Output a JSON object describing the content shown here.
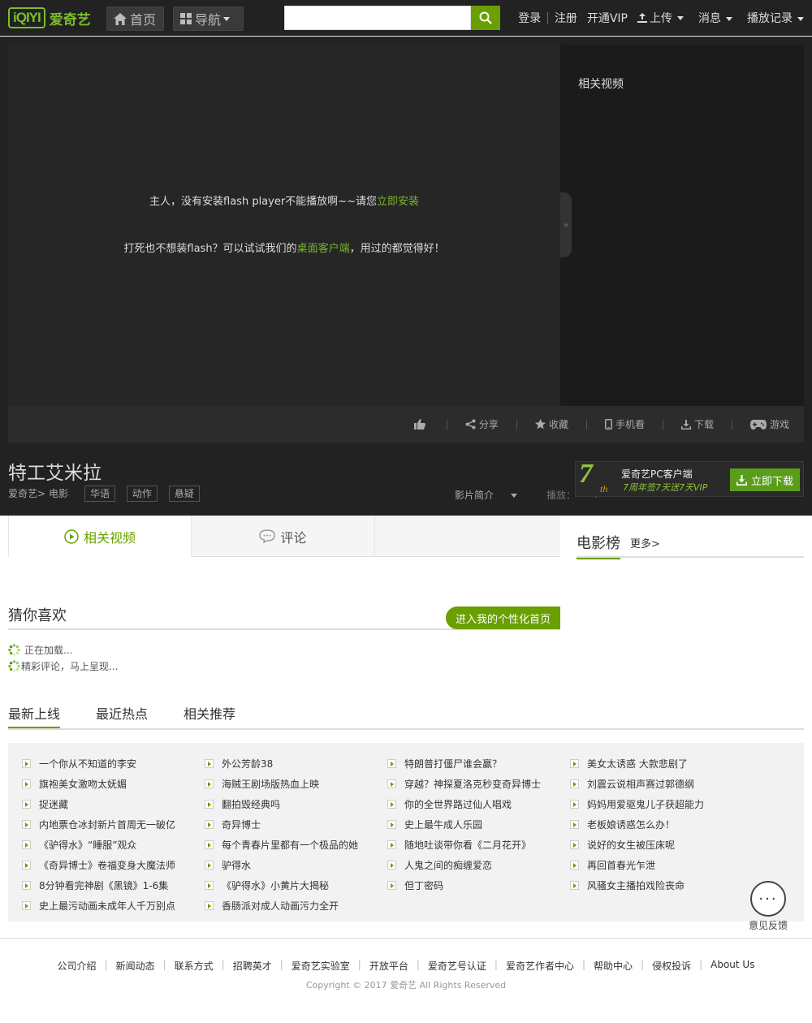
{
  "header": {
    "logo_mark": "iQIYI",
    "logo_cn": "爱奇艺",
    "home_label": "首页",
    "nav_label": "导航",
    "search_placeholder": "",
    "links": {
      "login": "登录",
      "register": "注册",
      "vip": "开通VIP",
      "upload": "上传",
      "messages": "消息",
      "history": "播放记录"
    }
  },
  "player": {
    "msg1_prefix": "主人，没有安装flash player不能播放啊~~请您",
    "msg1_link": "立即安装",
    "msg2_prefix": "打死也不想装flash？可以试试我们的",
    "msg2_link": "桌面客户端",
    "msg2_suffix": "，用过的都觉得好！",
    "side_title": "相关视频",
    "collapse_glyph": "»"
  },
  "toolbar": {
    "share": "分享",
    "favorite": "收藏",
    "mobile": "手机看",
    "download": "下载",
    "game": "游戏"
  },
  "video": {
    "title": "特工艾米拉",
    "crumb_site": "爱奇艺>",
    "crumb_cat": "电影",
    "tags": [
      "华语",
      "动作",
      "悬疑"
    ],
    "intro": "影片简介",
    "play": "播放："
  },
  "promo": {
    "seven": "7",
    "th": "th",
    "line1": "爱奇艺PC客户端",
    "line2": "7周年签7天送7天VIP",
    "button": "立即下载"
  },
  "tabs": {
    "related": "相关视频",
    "comments": "评论"
  },
  "rank": {
    "title": "电影榜",
    "more": "更多>"
  },
  "guess": {
    "title": "猜你喜欢",
    "button": "进入我的个性化首页",
    "loading1": "正在加载...",
    "loading2": "精彩评论，马上呈现..."
  },
  "subtabs": [
    "最新上线",
    "最近热点",
    "相关推荐"
  ],
  "lists": {
    "col1": [
      "一个你从不知道的李安",
      "旗袍美女激吻太妩媚",
      "捉迷藏",
      "内地票仓冰封新片首周无一破亿",
      "《驴得水》“睡服”观众",
      "《奇异博士》卷福变身大魔法师",
      "8分钟看完神剧《黑镜》1-6集",
      "史上最污动画未成年人千万别点"
    ],
    "col2": [
      "外公芳龄38",
      "海贼王剧场版热血上映",
      "翻拍毁经典吗",
      "奇异博士",
      "每个青春片里都有一个极品的她",
      "驴得水",
      "《驴得水》小黄片大揭秘",
      "香肠派对成人动画污力全开"
    ],
    "col3": [
      "特朗普打僵尸谁会赢？",
      "穿越？神探夏洛克秒变奇异博士",
      "你的全世界路过仙人唱戏",
      "史上最牛成人乐园",
      "随地吐谈带你看《二月花开》",
      "人鬼之间的痴缠爱恋",
      "但丁密码"
    ],
    "col4": [
      "美女太诱惑 大款悲剧了",
      "刘震云说相声赛过郭德纲",
      "妈妈用爱驱鬼儿子获超能力",
      "老板娘诱惑怎么办！",
      "说好的女生被压床呢",
      "再回首春光乍泄",
      "风骚女主播拍戏险丧命"
    ]
  },
  "feedback": {
    "glyph": "···",
    "label": "意见反馈"
  },
  "footer": {
    "links": [
      "公司介绍",
      "新闻动态",
      "联系方式",
      "招聘英才",
      "爱奇艺实验室",
      "开放平台",
      "爱奇艺号认证",
      "爱奇艺作者中心",
      "帮助中心",
      "侵权投诉",
      "About Us"
    ],
    "copyright": "Copyright © 2017 爱奇艺 All Rights Reserved"
  },
  "colors": {
    "brand_green": "#699f00",
    "dark_bg": "#222222"
  }
}
